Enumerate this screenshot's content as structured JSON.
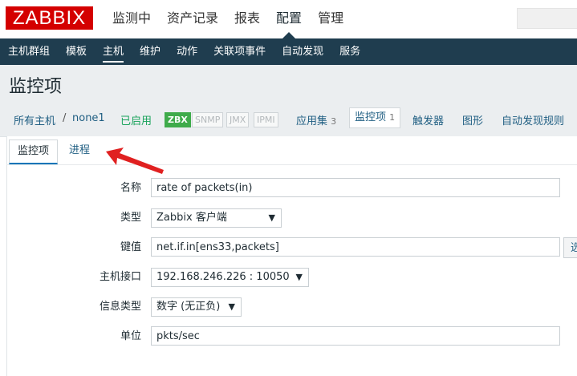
{
  "logo": "ZABBIX",
  "top_menu": [
    "监测中",
    "资产记录",
    "报表",
    "配置",
    "管理"
  ],
  "sub_menu": [
    "主机群组",
    "模板",
    "主机",
    "维护",
    "动作",
    "关联项事件",
    "自动发现",
    "服务"
  ],
  "page_title": "监控项",
  "breadcrumb": {
    "all_hosts": "所有主机",
    "separator": "/",
    "host": "none1",
    "status": "已启用",
    "badges": [
      "ZBX",
      "SNMP",
      "JMX",
      "IPMI"
    ],
    "applications": "应用集",
    "applications_count": "3",
    "items": "监控项",
    "items_count": "1",
    "triggers": "触发器",
    "graphs": "图形",
    "discovery": "自动发现规则"
  },
  "tabs": [
    "监控项",
    "进程"
  ],
  "form": {
    "name_label": "名称",
    "name_value": "rate of packets(in)",
    "type_label": "类型",
    "type_value": "Zabbix 客户端",
    "key_label": "键值",
    "key_value": "net.if.in[ens33,packets]",
    "key_button": "选",
    "interface_label": "主机接口",
    "interface_value": "192.168.246.226 : 10050",
    "info_type_label": "信息类型",
    "info_type_value": "数字 (无正负)",
    "units_label": "单位",
    "units_value": "pkts/sec"
  },
  "colors": {
    "logo_red": "#d40000",
    "submenu_bg": "#1f3d4f",
    "enabled_green": "#19a35b",
    "arrow_red": "#e02020",
    "link_blue": "#1f5e82"
  },
  "icons": {
    "select_caret": "caret-down-icon",
    "annotation": "red-arrow-icon"
  }
}
